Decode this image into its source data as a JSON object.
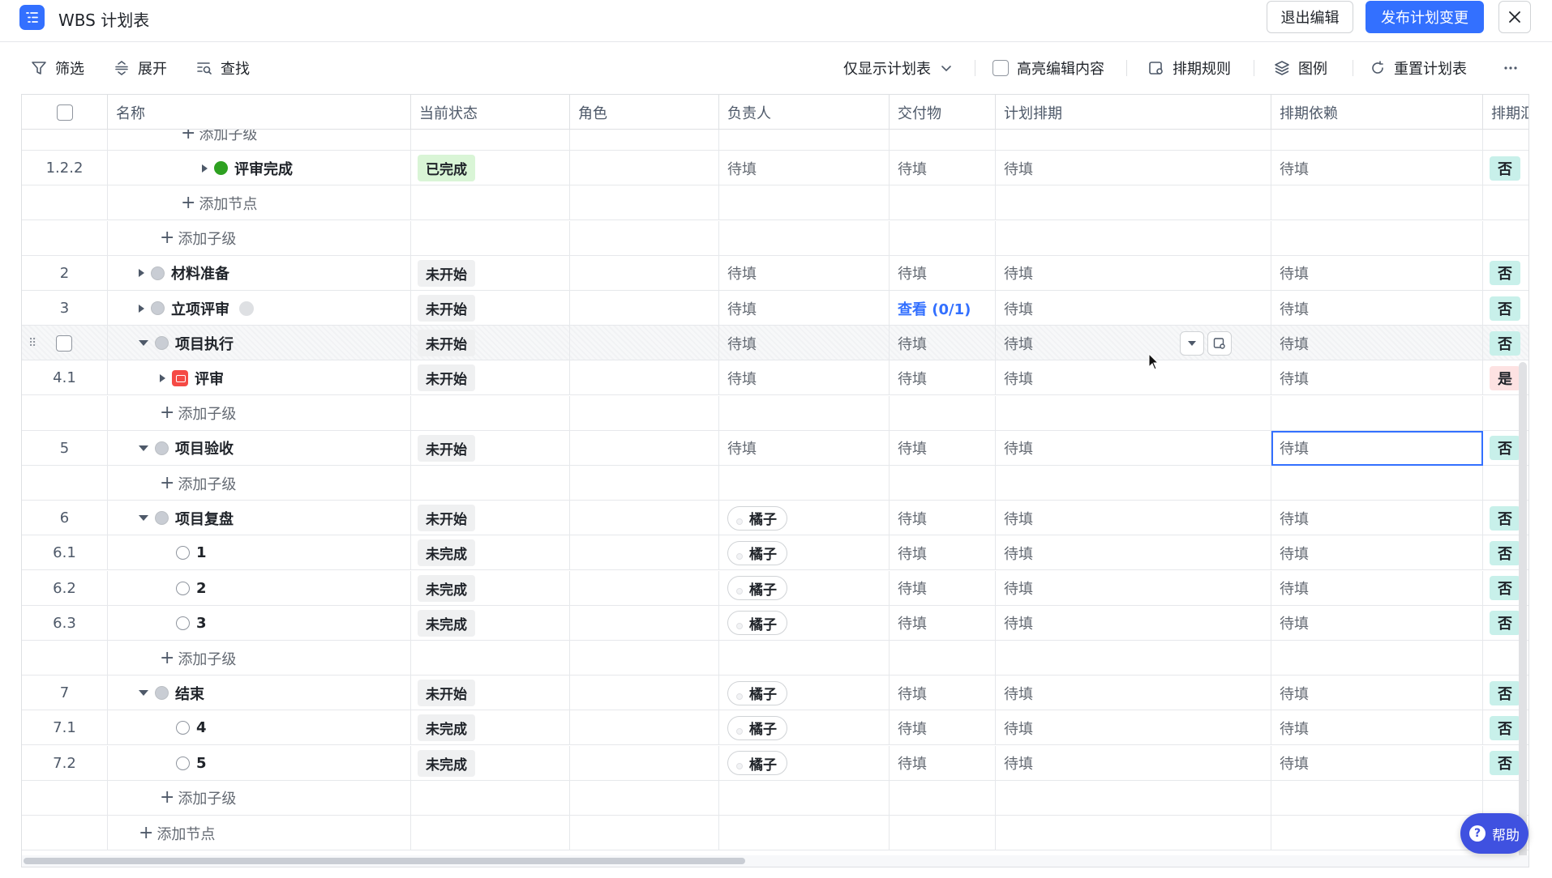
{
  "app": {
    "title": "WBS 计划表",
    "exit_label": "退出编辑",
    "publish_label": "发布计划变更",
    "accent": "#3370ff"
  },
  "toolbar": {
    "filter": "筛选",
    "expand": "展开",
    "find": "查找",
    "view_select": "仅显示计划表",
    "highlight": "高亮编辑内容",
    "schedule_rules": "排期规则",
    "legend": "图例",
    "reset": "重置计划表"
  },
  "columns": {
    "name": "名称",
    "status": "当前状态",
    "role": "角色",
    "owner": "负责人",
    "deliverable": "交付物",
    "plan": "计划排期",
    "dependency": "排期依赖",
    "summary": "排期汇总"
  },
  "rows": [
    {
      "wbs": "",
      "kind": "add",
      "label": "添加子级",
      "indent": 3
    },
    {
      "wbs": "1.2.2",
      "kind": "task",
      "name": "评审完成",
      "status": "已完成",
      "status_type": "done",
      "icon": "green",
      "arrow": "right",
      "indent": 4,
      "owner": "待填",
      "deliverable": "待填",
      "plan": "待填",
      "dependency": "待填",
      "summary": "否"
    },
    {
      "wbs": "",
      "kind": "add",
      "label": "添加节点",
      "indent": 3
    },
    {
      "wbs": "",
      "kind": "add",
      "label": "添加子级",
      "indent": 2
    },
    {
      "wbs": "2",
      "kind": "task",
      "name": "材料准备",
      "status": "未开始",
      "status_type": "gray",
      "icon": "gray",
      "arrow": "right",
      "indent": 1,
      "owner": "待填",
      "deliverable": "待填",
      "plan": "待填",
      "dependency": "待填",
      "summary": "否"
    },
    {
      "wbs": "3",
      "kind": "task",
      "name": "立项评审",
      "status": "未开始",
      "status_type": "gray",
      "icon": "gray",
      "arrow": "right",
      "indent": 1,
      "owner": "待填",
      "deliverable": "查看 (0/1)",
      "deliverable_link": true,
      "plan": "待填",
      "dependency": "待填",
      "summary": "否",
      "badge": true
    },
    {
      "wbs": "",
      "kind": "task",
      "name": "项目执行",
      "status": "未开始",
      "status_type": "gray",
      "icon": "gray",
      "arrow": "down",
      "indent": 1,
      "owner": "待填",
      "deliverable": "待填",
      "plan": "待填",
      "dependency": "待填",
      "summary": "否",
      "hover": true
    },
    {
      "wbs": "4.1",
      "kind": "task",
      "name": "评审",
      "status": "未开始",
      "status_type": "gray",
      "icon": "red",
      "arrow": "right",
      "indent": 2,
      "owner": "待填",
      "deliverable": "待填",
      "plan": "待填",
      "dependency": "待填",
      "summary": "是"
    },
    {
      "wbs": "",
      "kind": "add",
      "label": "添加子级",
      "indent": 2
    },
    {
      "wbs": "5",
      "kind": "task",
      "name": "项目验收",
      "status": "未开始",
      "status_type": "gray",
      "icon": "gray",
      "arrow": "down",
      "indent": 1,
      "owner": "待填",
      "deliverable": "待填",
      "plan": "待填",
      "dependency": "待填",
      "summary": "否",
      "selected": true
    },
    {
      "wbs": "",
      "kind": "add",
      "label": "添加子级",
      "indent": 2
    },
    {
      "wbs": "6",
      "kind": "task",
      "name": "项目复盘",
      "status": "未开始",
      "status_type": "gray",
      "icon": "gray",
      "arrow": "down",
      "indent": 1,
      "owner": "橘子",
      "owner_chip": true,
      "deliverable": "待填",
      "plan": "待填",
      "dependency": "待填",
      "summary": "否"
    },
    {
      "wbs": "6.1",
      "kind": "task",
      "name": "1",
      "status": "未完成",
      "status_type": "gray",
      "icon": "open",
      "arrow": "none",
      "indent": 2,
      "owner": "橘子",
      "owner_chip": true,
      "deliverable": "待填",
      "plan": "待填",
      "dependency": "待填",
      "summary": "否"
    },
    {
      "wbs": "6.2",
      "kind": "task",
      "name": "2",
      "status": "未完成",
      "status_type": "gray",
      "icon": "open",
      "arrow": "none",
      "indent": 2,
      "owner": "橘子",
      "owner_chip": true,
      "deliverable": "待填",
      "plan": "待填",
      "dependency": "待填",
      "summary": "否"
    },
    {
      "wbs": "6.3",
      "kind": "task",
      "name": "3",
      "status": "未完成",
      "status_type": "gray",
      "icon": "open",
      "arrow": "none",
      "indent": 2,
      "owner": "橘子",
      "owner_chip": true,
      "deliverable": "待填",
      "plan": "待填",
      "dependency": "待填",
      "summary": "否"
    },
    {
      "wbs": "",
      "kind": "add",
      "label": "添加子级",
      "indent": 2
    },
    {
      "wbs": "7",
      "kind": "task",
      "name": "结束",
      "status": "未开始",
      "status_type": "gray",
      "icon": "gray",
      "arrow": "down",
      "indent": 1,
      "owner": "橘子",
      "owner_chip": true,
      "deliverable": "待填",
      "plan": "待填",
      "dependency": "待填",
      "summary": "否"
    },
    {
      "wbs": "7.1",
      "kind": "task",
      "name": "4",
      "status": "未完成",
      "status_type": "gray",
      "icon": "open",
      "arrow": "none",
      "indent": 2,
      "owner": "橘子",
      "owner_chip": true,
      "deliverable": "待填",
      "plan": "待填",
      "dependency": "待填",
      "summary": "否"
    },
    {
      "wbs": "7.2",
      "kind": "task",
      "name": "5",
      "status": "未完成",
      "status_type": "gray",
      "icon": "open",
      "arrow": "none",
      "indent": 2,
      "owner": "橘子",
      "owner_chip": true,
      "deliverable": "待填",
      "plan": "待填",
      "dependency": "待填",
      "summary": "否"
    },
    {
      "wbs": "",
      "kind": "add",
      "label": "添加子级",
      "indent": 2
    },
    {
      "wbs": "",
      "kind": "add",
      "label": "添加节点",
      "indent": 1
    }
  ],
  "help": {
    "label": "帮助"
  }
}
